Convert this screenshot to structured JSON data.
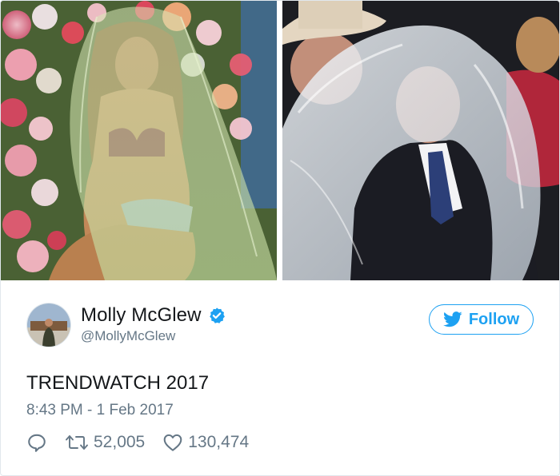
{
  "tweet": {
    "author_name": "Molly McGlew",
    "author_handle": "@MollyMcGlew",
    "follow_label": "Follow",
    "text": "TRENDWATCH 2017",
    "timestamp": "8:43 PM - 1 Feb 2017",
    "retweet_count": "52,005",
    "like_count": "130,474"
  },
  "icons": {
    "verified": "verified-badge-icon",
    "follow": "twitter-bird-icon",
    "reply": "reply-icon",
    "retweet": "retweet-icon",
    "like": "heart-icon"
  },
  "colors": {
    "accent": "#1da1f2",
    "text": "#14171a",
    "muted": "#657786",
    "border": "#e1e8ed"
  }
}
